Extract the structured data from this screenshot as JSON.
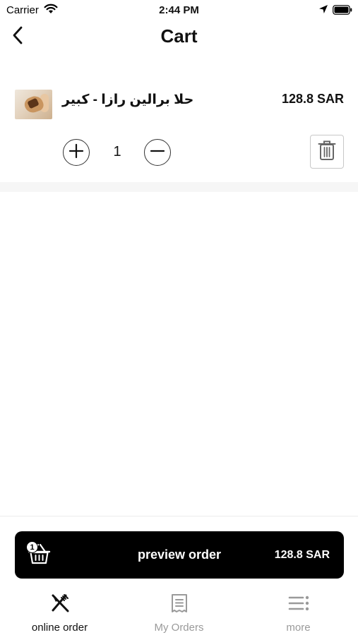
{
  "status_bar": {
    "carrier": "Carrier",
    "time": "2:44 PM"
  },
  "header": {
    "title": "Cart",
    "back_icon": "chevron-left-icon"
  },
  "cart": {
    "items": [
      {
        "name": "حلا برالين رازا - كبير",
        "price": "128.8 SAR",
        "quantity": "1"
      }
    ]
  },
  "preview": {
    "label": "preview order",
    "total": "128.8 SAR",
    "badge_count": "1"
  },
  "tabs": [
    {
      "label": "online order",
      "icon": "fork-knife-icon",
      "active": true
    },
    {
      "label": "My Orders",
      "icon": "receipt-icon",
      "active": false
    },
    {
      "label": "more",
      "icon": "menu-icon",
      "active": false
    }
  ],
  "colors": {
    "primary": "#000000",
    "inactive": "#9a9a9a",
    "band": "#f6f6f6"
  }
}
